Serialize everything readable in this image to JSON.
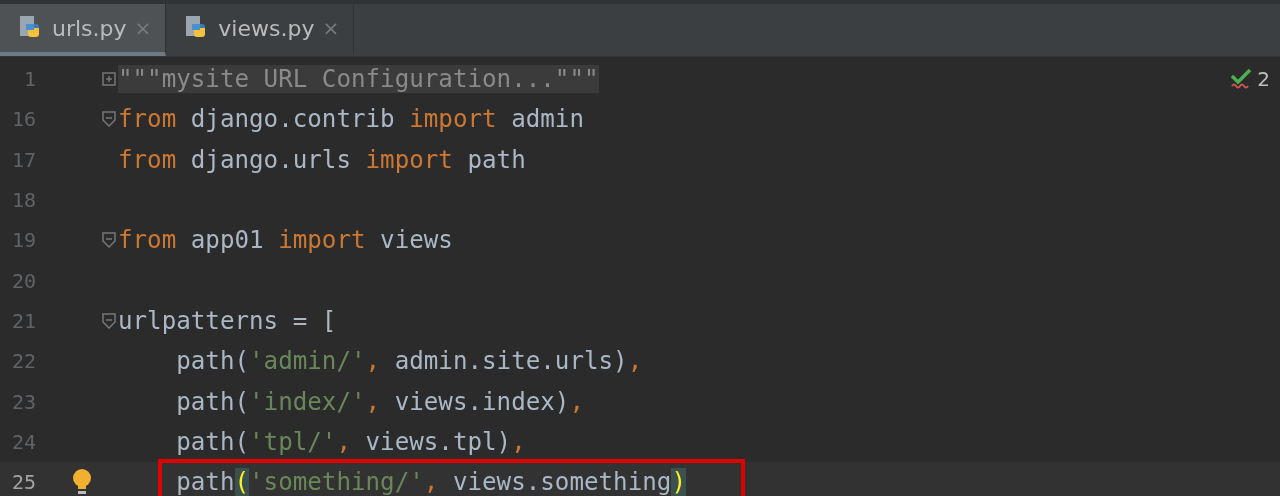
{
  "tabs": [
    {
      "label": "urls.py",
      "close": "×",
      "selected": true
    },
    {
      "label": "views.py",
      "close": "×",
      "selected": false
    }
  ],
  "inspection": {
    "count": "2"
  },
  "lines": [
    {
      "number": "1",
      "fold": true,
      "folded": true,
      "current": false,
      "bulb": false,
      "boxed": false,
      "tokens": [
        {
          "text": "\"\"\"mysite URL Configuration...\"\"\"",
          "kind": "folded"
        }
      ]
    },
    {
      "number": "16",
      "fold": true,
      "folded": false,
      "current": false,
      "bulb": false,
      "boxed": false,
      "tokens": [
        {
          "text": "from",
          "kind": "keyword"
        },
        {
          "text": " django.contrib ",
          "kind": "plain"
        },
        {
          "text": "import",
          "kind": "keyword"
        },
        {
          "text": " admin",
          "kind": "plain"
        }
      ]
    },
    {
      "number": "17",
      "fold": false,
      "current": false,
      "bulb": false,
      "boxed": false,
      "tokens": [
        {
          "text": "from",
          "kind": "keyword"
        },
        {
          "text": " django.urls ",
          "kind": "plain"
        },
        {
          "text": "import",
          "kind": "keyword"
        },
        {
          "text": " path",
          "kind": "plain"
        }
      ]
    },
    {
      "number": "18",
      "fold": false,
      "current": false,
      "bulb": false,
      "boxed": false
    },
    {
      "number": "19",
      "fold": true,
      "folded": false,
      "current": false,
      "bulb": false,
      "boxed": false,
      "tokens": [
        {
          "text": "from",
          "kind": "keyword"
        },
        {
          "text": " app01 ",
          "kind": "plain"
        },
        {
          "text": "import",
          "kind": "keyword"
        },
        {
          "text": " views",
          "kind": "plain"
        }
      ]
    },
    {
      "number": "20",
      "fold": false,
      "current": false,
      "bulb": false,
      "boxed": false
    },
    {
      "number": "21",
      "fold": true,
      "folded": false,
      "current": false,
      "bulb": false,
      "boxed": false,
      "tokens": [
        {
          "text": "urlpatterns = [",
          "kind": "plain"
        }
      ]
    },
    {
      "number": "22",
      "fold": false,
      "current": false,
      "bulb": false,
      "boxed": false,
      "tokens": [
        {
          "text": "    path(",
          "kind": "plain"
        },
        {
          "text": "'admin/'",
          "kind": "string"
        },
        {
          "text": ",",
          "kind": "comma"
        },
        {
          "text": " admin.site.urls)",
          "kind": "plain"
        },
        {
          "text": ",",
          "kind": "comma"
        }
      ]
    },
    {
      "number": "23",
      "fold": false,
      "current": false,
      "bulb": false,
      "boxed": false,
      "tokens": [
        {
          "text": "    path(",
          "kind": "plain"
        },
        {
          "text": "'index/'",
          "kind": "string"
        },
        {
          "text": ",",
          "kind": "comma"
        },
        {
          "text": " views.index)",
          "kind": "plain"
        },
        {
          "text": ",",
          "kind": "comma"
        }
      ]
    },
    {
      "number": "24",
      "fold": false,
      "current": false,
      "bulb": false,
      "boxed": false,
      "tokens": [
        {
          "text": "    path(",
          "kind": "plain"
        },
        {
          "text": "'tpl/'",
          "kind": "string"
        },
        {
          "text": ",",
          "kind": "comma"
        },
        {
          "text": " views.tpl)",
          "kind": "plain"
        },
        {
          "text": ",",
          "kind": "comma"
        }
      ]
    },
    {
      "number": "25",
      "fold": false,
      "current": true,
      "bulb": true,
      "boxed": true,
      "tokens": [
        {
          "text": "    path",
          "kind": "plain"
        },
        {
          "text": "(",
          "kind": "matched"
        },
        {
          "text": "'something/'",
          "kind": "string"
        },
        {
          "text": ",",
          "kind": "comma"
        },
        {
          "text": " views.something",
          "kind": "plain"
        },
        {
          "text": ")",
          "kind": "matched"
        }
      ]
    }
  ]
}
